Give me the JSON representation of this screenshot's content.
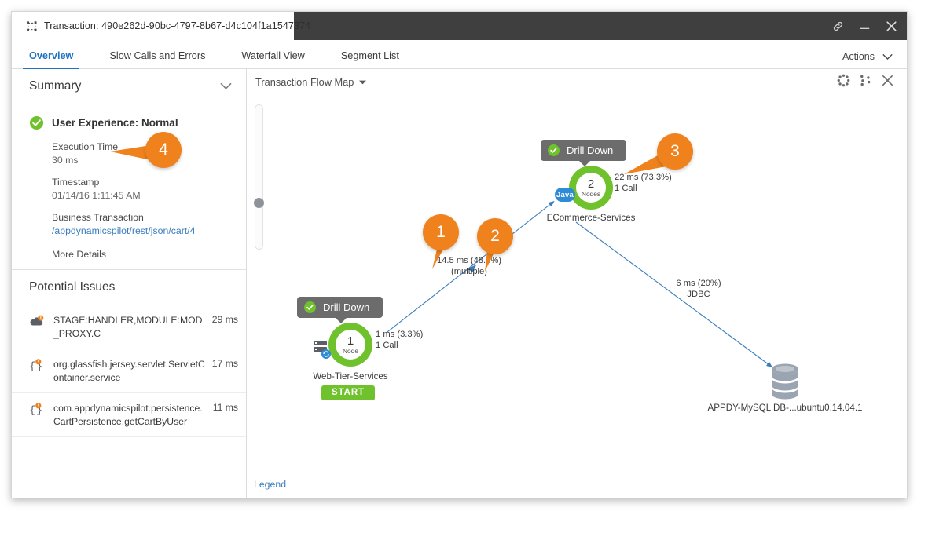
{
  "window": {
    "tab_title": "Transaction: 490e262d-90bc-4797-8b67-d4c104f1a1547374",
    "tab_icon": "transaction-snapshot-icon",
    "controls": {
      "link_icon": "link-icon",
      "minimize_icon": "minimize-icon",
      "close_icon": "close-icon"
    }
  },
  "tabs": [
    {
      "label": "Overview",
      "active": true
    },
    {
      "label": "Slow Calls and Errors",
      "active": false
    },
    {
      "label": "Waterfall View",
      "active": false
    },
    {
      "label": "Segment List",
      "active": false
    }
  ],
  "actions": {
    "label": "Actions",
    "caret_icon": "chevron-down-icon"
  },
  "sidebar": {
    "summary": {
      "title": "Summary",
      "collapse_icon": "chevron-down-icon",
      "user_experience": {
        "status_icon": "check-circle-icon",
        "label": "User Experience: Normal"
      },
      "fields": [
        {
          "key": "Execution Time",
          "value": "30 ms"
        },
        {
          "key": "Timestamp",
          "value": "01/14/16 1:11:45 AM"
        },
        {
          "key": "Business Transaction",
          "value": "/appdynamicspilot/rest/json/cart/4",
          "is_link": true
        }
      ],
      "more_details": "More Details"
    },
    "potential_issues": {
      "title": "Potential Issues",
      "items": [
        {
          "icon": "cloud-warning-icon",
          "name": "STAGE:HANDLER,MODULE:MOD_PROXY.C",
          "time": "29 ms"
        },
        {
          "icon": "code-warning-icon",
          "name": "org.glassfish.jersey.servlet.ServletContainer.service",
          "time": "17 ms"
        },
        {
          "icon": "code-warning-icon",
          "name": "com.appdynamicspilot.persistence.CartPersistence.getCartByUser",
          "time": "11 ms"
        }
      ]
    }
  },
  "map": {
    "title": "Transaction Flow Map",
    "title_caret_icon": "caret-down-icon",
    "tools": [
      {
        "icon": "circular-layout-icon",
        "name": "circular-layout-tool"
      },
      {
        "icon": "scatter-layout-icon",
        "name": "scatter-layout-tool"
      },
      {
        "icon": "expand-icon",
        "name": "fullscreen-tool"
      }
    ],
    "zoom_slider": {
      "name": "zoom-slider",
      "value_pct": 36
    },
    "legend_link": "Legend",
    "nodes": [
      {
        "id": "web-tier",
        "tooltip": "Drill Down",
        "tooltip_status_icon": "check-circle-icon",
        "count": "1",
        "unit": "Node",
        "label": "Web-Tier-Services",
        "tier_icon": "server-stack-icon",
        "badge": "START",
        "metrics": [
          "1 ms (3.3%)",
          "1 Call"
        ]
      },
      {
        "id": "ecommerce",
        "tooltip": "Drill Down",
        "tooltip_status_icon": "check-circle-icon",
        "count": "2",
        "unit": "Nodes",
        "label": "ECommerce-Services",
        "tech_badge": "Java",
        "metrics": [
          "22 ms (73.3%)",
          "1 Call"
        ]
      },
      {
        "id": "mysql-db",
        "icon": "database-icon",
        "label": "APPDY-MySQL DB-...ubuntu0.14.04.1"
      }
    ],
    "edges": [
      {
        "from": "web-tier",
        "to": "ecommerce",
        "label_line1": "14.5 ms (48.3%)",
        "label_line2": "(multiple)"
      },
      {
        "from": "ecommerce",
        "to": "mysql-db",
        "label_line1": "6 ms (20%)",
        "label_line2": "JDBC"
      }
    ],
    "callouts": [
      {
        "number": "1"
      },
      {
        "number": "2"
      },
      {
        "number": "3"
      },
      {
        "number": "4"
      }
    ]
  },
  "colors": {
    "accent_blue": "#1f72c0",
    "green": "#6fc22c",
    "orange": "#f0821e",
    "edge_blue": "#3a7dbd",
    "tooltip_gray": "#6c6c6c"
  }
}
